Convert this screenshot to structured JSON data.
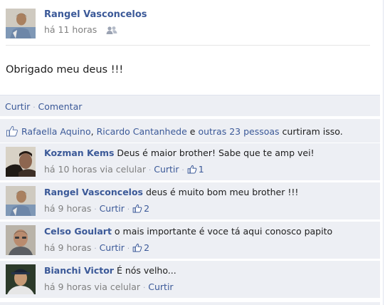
{
  "post": {
    "author": "Rangel Vasconcelos",
    "time": "há 11 horas",
    "privacy_icon": "friends-icon",
    "message": "Obrigado meu deus !!!"
  },
  "actions": {
    "like_label": "Curtir",
    "comment_label": "Comentar",
    "separator": "·"
  },
  "likes": {
    "icon": "thumbs-up-icon",
    "name1": "Rafaella Aquino",
    "comma": ", ",
    "name2": "Ricardo Cantanhede",
    "and_text": " e ",
    "others": "outras 23 pessoas",
    "suffix": " curtiram isso."
  },
  "comments": [
    {
      "author": "Kozman Kems",
      "text": " Deus é maior brother! Sabe que te amp vei!",
      "time": "há 10 horas via celular",
      "like_label": "Curtir",
      "like_count": "1"
    },
    {
      "author": "Rangel Vasconcelos",
      "text": " deus é muito bom meu brother !!!",
      "time": "há 9 horas",
      "like_label": "Curtir",
      "like_count": "2"
    },
    {
      "author": "Celso Goulart",
      "text": " o mais importante é voce tá aqui conosco papito",
      "time": "há 9 horas",
      "like_label": "Curtir",
      "like_count": "2"
    },
    {
      "author": "Bianchi Victor",
      "text": " É nós velho...",
      "time": "há 9 horas via celular",
      "like_label": "Curtir",
      "like_count": null
    }
  ],
  "colors": {
    "link": "#3b5998",
    "panel_bg": "#edeff4",
    "meta_gray": "#808080"
  }
}
